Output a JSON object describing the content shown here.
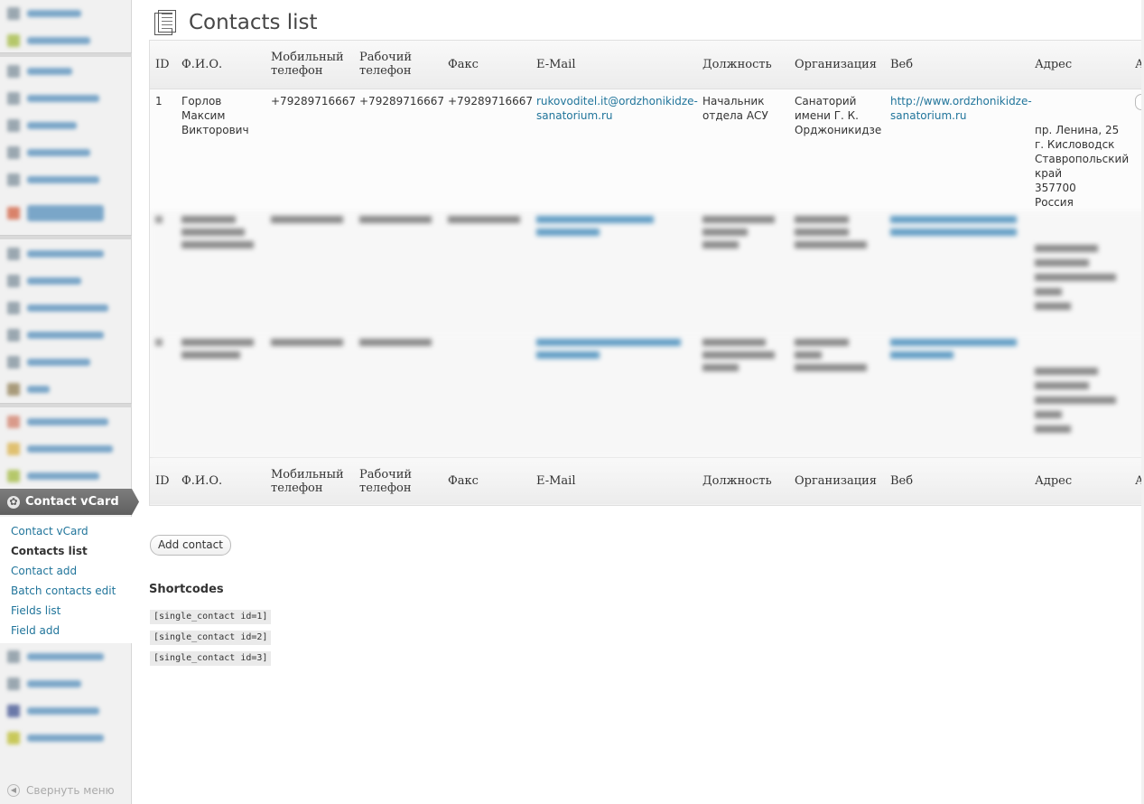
{
  "page": {
    "title": "Contacts list"
  },
  "sidebar": {
    "current_menu": {
      "label": "Contact vCard",
      "icon": "gear-icon"
    },
    "submenu": [
      {
        "label": "Contact vCard",
        "current": false
      },
      {
        "label": "Contacts list",
        "current": true
      },
      {
        "label": "Contact add",
        "current": false
      },
      {
        "label": "Batch contacts edit",
        "current": false
      },
      {
        "label": "Fields list",
        "current": false
      },
      {
        "label": "Field add",
        "current": false
      }
    ],
    "collapse_label": "Свернуть меню"
  },
  "table": {
    "columns": [
      "ID",
      "Ф.И.О.",
      "Мобильный телефон",
      "Рабочий телефон",
      "Факс",
      "E-Mail",
      "Должность",
      "Организация",
      "Веб",
      "Адрес",
      "А"
    ],
    "rows": [
      {
        "id": "1",
        "name": "Горлов Максим Викторович",
        "mobile": "+79289716667",
        "work": "+79289716667",
        "fax": "+79289716667",
        "email": "rukovoditel.it@ordzhonikidze-sanatorium.ru",
        "position": "Начальник отдела АСУ",
        "organization": "Санаторий имени Г. К. Орджоникидзе",
        "web": "http://www.ordzhonikidze-sanatorium.ru",
        "address": [
          "пр. Ленина, 25",
          "г. Кисловодск",
          "Ставропольский край",
          "357700",
          "Россия"
        ]
      }
    ]
  },
  "buttons": {
    "add_contact": "Add contact"
  },
  "shortcodes": {
    "heading": "Shortcodes",
    "items": [
      "[single_contact id=1]",
      "[single_contact id=2]",
      "[single_contact id=3]"
    ]
  }
}
